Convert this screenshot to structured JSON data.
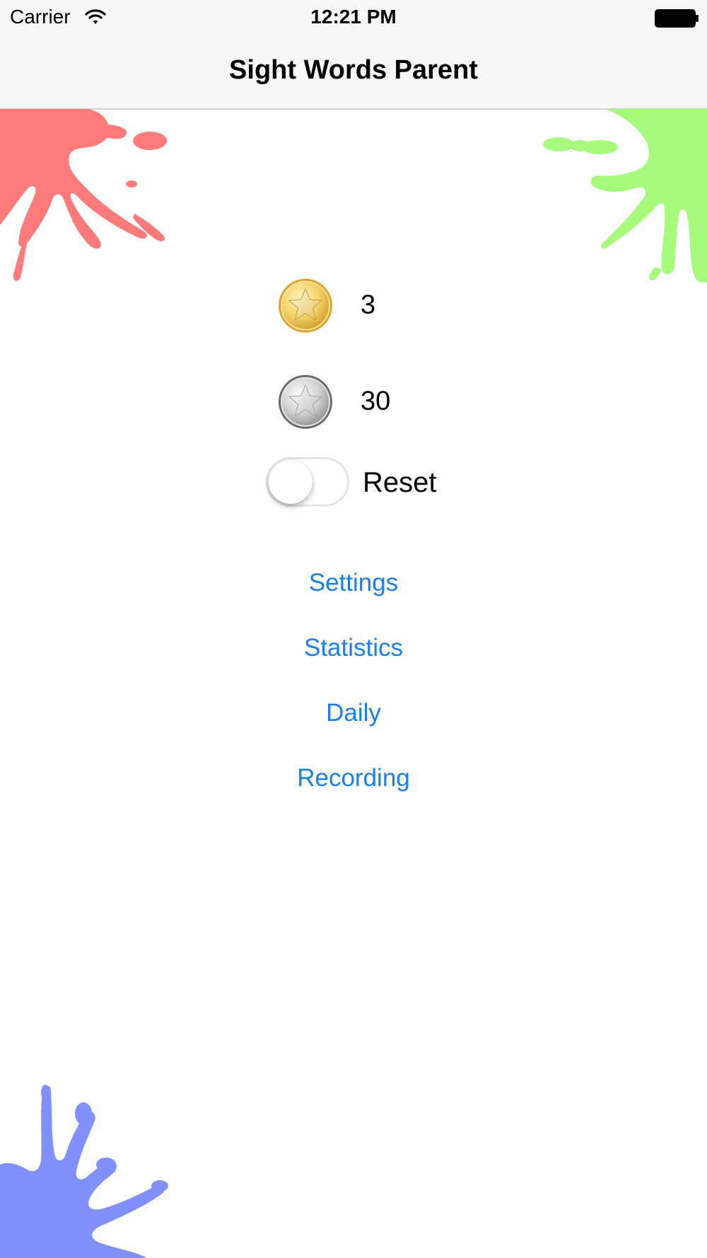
{
  "status_bar": {
    "carrier": "Carrier",
    "time": "12:21 PM",
    "wifi_icon": "wifi-icon",
    "battery_icon": "battery-icon"
  },
  "nav_bar": {
    "title": "Sight Words Parent"
  },
  "medals": [
    {
      "icon": "gold-star-medal-icon",
      "count": "3",
      "color": "#e2b43c"
    },
    {
      "icon": "silver-star-medal-icon",
      "count": "30",
      "color": "#9a9a9a"
    }
  ],
  "reset": {
    "label": "Reset",
    "on": false
  },
  "links": {
    "settings": "Settings",
    "statistics": "Statistics",
    "daily": "Daily",
    "recording": "Recording"
  },
  "colors": {
    "link": "#1a7fe7",
    "splat_red": "#ff7b7b",
    "splat_green": "#a6fb7d",
    "splat_blue": "#8290fd"
  }
}
